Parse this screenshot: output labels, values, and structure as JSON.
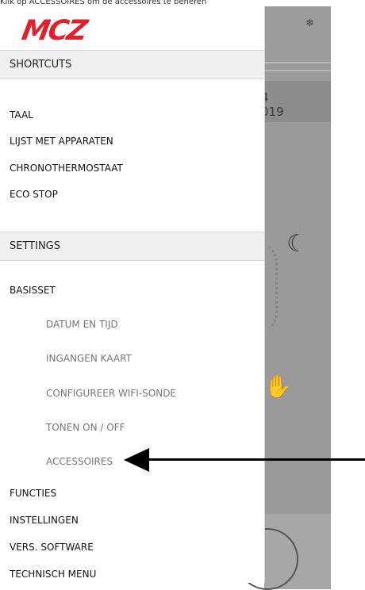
{
  "caption": "Klik op ACCESSOIRES om de accessoires te beheren",
  "brand": {
    "logo_text": "MCZ",
    "color": "#e0202a"
  },
  "menu": {
    "shortcuts_header": "SHORTCUTS",
    "shortcuts": [
      "TAAL",
      "LIJST MET APPARATEN",
      "CHRONOTHERMOSTAAT",
      "ECO STOP"
    ],
    "settings_header": "SETTINGS",
    "settings": {
      "basisset": "BASISSET",
      "basisset_items": [
        "DATUM EN TIJD",
        "INGANGEN KAART",
        "CONFIGUREER WIFI-SONDE",
        "TONEN ON / OFF",
        "ACCESSOIRES"
      ],
      "others": [
        "FUNCTIES",
        "INSTELLINGEN",
        "VERS. SOFTWARE",
        "TECHNISCH MENU"
      ]
    }
  },
  "background_app": {
    "band_text": "4\n019",
    "icons": [
      "snowflake-icon",
      "moon-stars-icon",
      "hand-stop-icon"
    ]
  },
  "annotation": {
    "arrow_target": "ACCESSOIRES"
  }
}
